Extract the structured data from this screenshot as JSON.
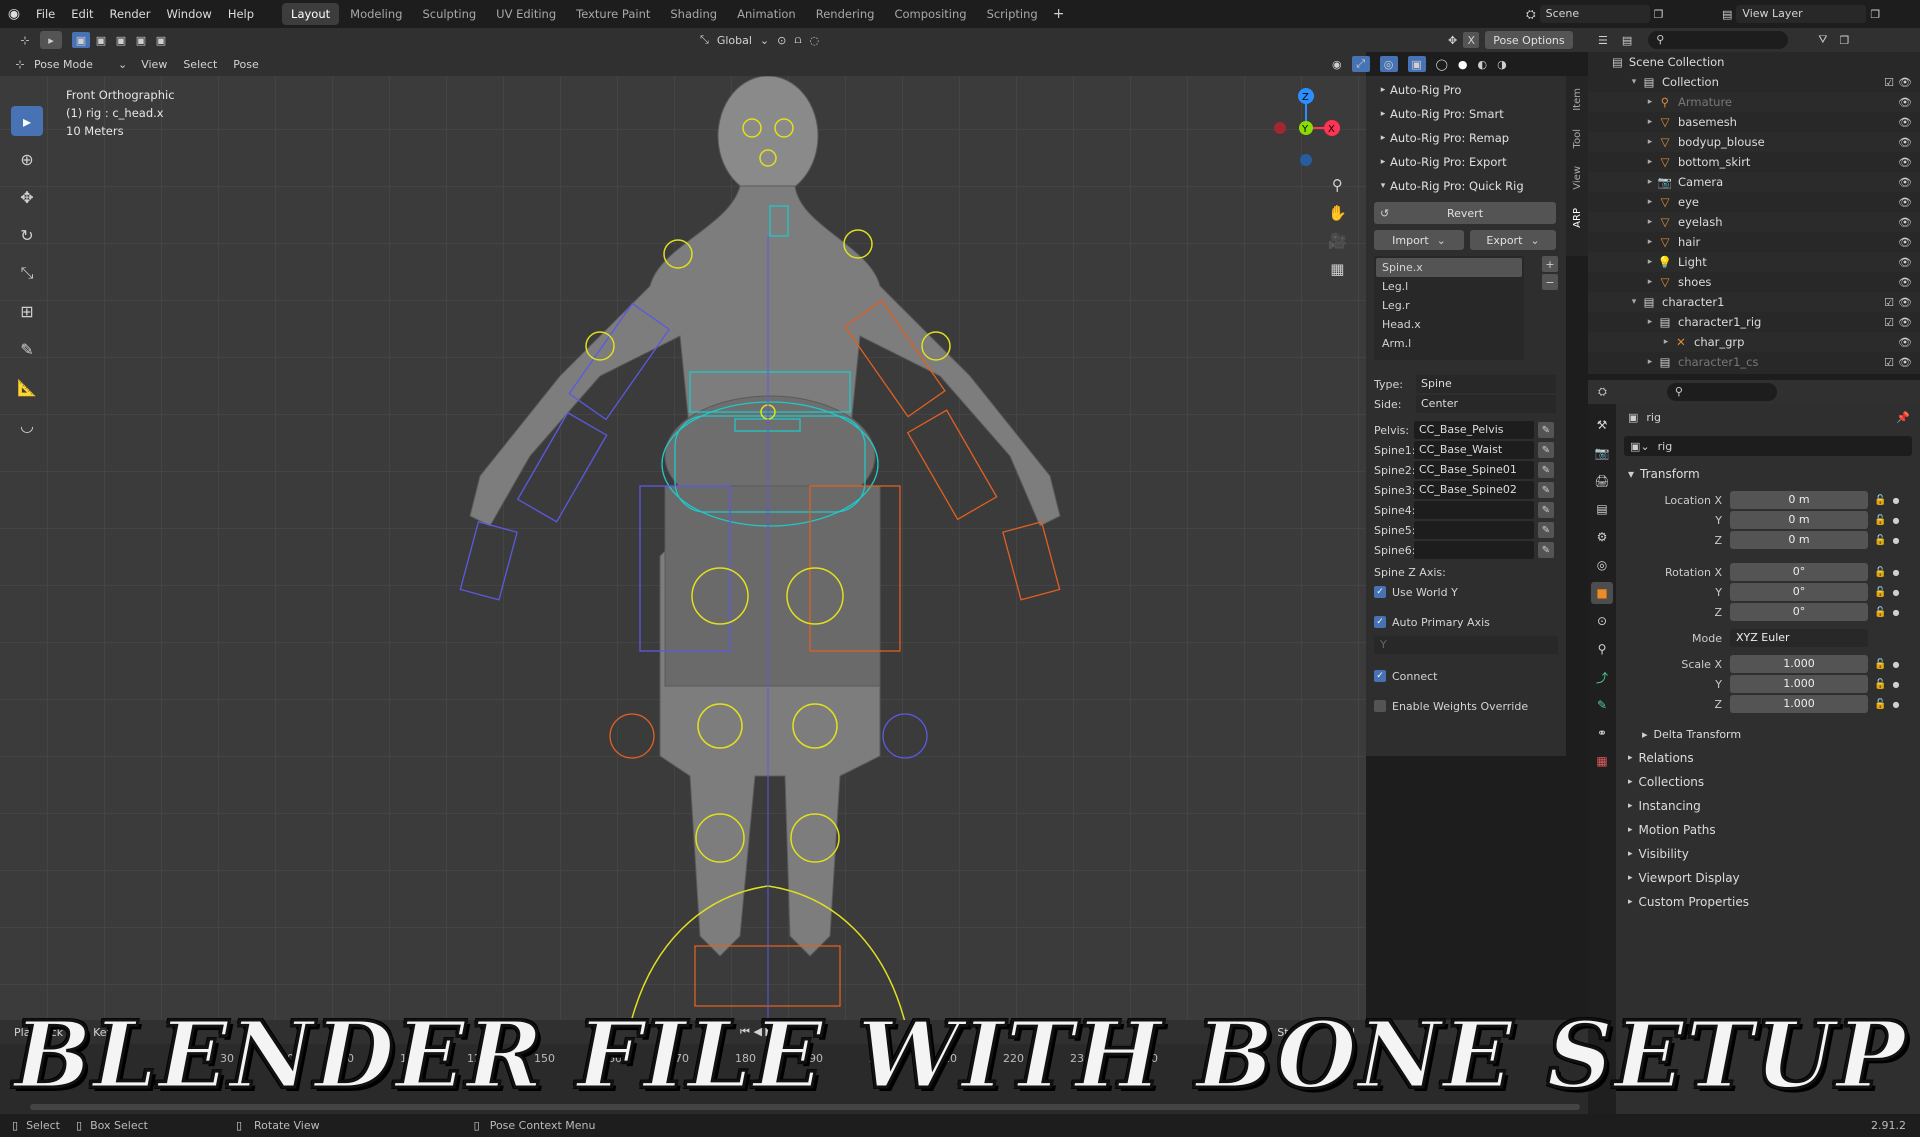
{
  "menu": [
    "File",
    "Edit",
    "Render",
    "Window",
    "Help"
  ],
  "workspaces": [
    "Layout",
    "Modeling",
    "Sculpting",
    "UV Editing",
    "Texture Paint",
    "Shading",
    "Animation",
    "Rendering",
    "Compositing",
    "Scripting"
  ],
  "active_workspace": "Layout",
  "scene_name": "Scene",
  "view_layer": "View Layer",
  "viewport_header": {
    "mode": "Pose Mode",
    "items": [
      "View",
      "Select",
      "Pose"
    ],
    "transform_orientation": "Global",
    "pose_options": "Pose Options"
  },
  "viewport_info": {
    "view": "Front Orthographic",
    "object": "(1) rig : c_head.x",
    "scale": "10 Meters"
  },
  "side_tabs": [
    "Item",
    "Tool",
    "View",
    "ARP"
  ],
  "arp_panel": {
    "sections": [
      "Auto-Rig Pro",
      "Auto-Rig Pro: Smart",
      "Auto-Rig Pro: Remap",
      "Auto-Rig Pro: Export",
      "Auto-Rig Pro: Quick Rig"
    ],
    "revert": "Revert",
    "import": "Import",
    "export": "Export",
    "limbs": [
      "Spine.x",
      "Leg.l",
      "Leg.r",
      "Head.x",
      "Arm.l"
    ],
    "type_label": "Type:",
    "type_value": "Spine",
    "side_label": "Side:",
    "side_value": "Center",
    "bones": [
      {
        "label": "Pelvis:",
        "value": "CC_Base_Pelvis"
      },
      {
        "label": "Spine1:",
        "value": "CC_Base_Waist"
      },
      {
        "label": "Spine2:",
        "value": "CC_Base_Spine01"
      },
      {
        "label": "Spine3:",
        "value": "CC_Base_Spine02"
      },
      {
        "label": "Spine4:",
        "value": ""
      },
      {
        "label": "Spine5:",
        "value": ""
      },
      {
        "label": "Spine6:",
        "value": ""
      }
    ],
    "spine_z_axis": "Spine Z Axis:",
    "use_world_y": "Use World Y",
    "auto_primary_axis": "Auto Primary Axis",
    "axis_value": "Y",
    "connect": "Connect",
    "enable_weights_override": "Enable Weights Override"
  },
  "outliner": {
    "root": "Scene Collection",
    "items": [
      {
        "name": "Collection",
        "indent": 1,
        "icon": "collection-icon"
      },
      {
        "name": "Armature",
        "indent": 2,
        "icon": "armature-icon",
        "dim": true
      },
      {
        "name": "basemesh",
        "indent": 2,
        "icon": "mesh-icon"
      },
      {
        "name": "bodyup_blouse",
        "indent": 2,
        "icon": "mesh-icon"
      },
      {
        "name": "bottom_skirt",
        "indent": 2,
        "icon": "mesh-icon"
      },
      {
        "name": "Camera",
        "indent": 2,
        "icon": "camera-icon"
      },
      {
        "name": "eye",
        "indent": 2,
        "icon": "mesh-icon"
      },
      {
        "name": "eyelash",
        "indent": 2,
        "icon": "mesh-icon"
      },
      {
        "name": "hair",
        "indent": 2,
        "icon": "mesh-icon"
      },
      {
        "name": "Light",
        "indent": 2,
        "icon": "light-icon"
      },
      {
        "name": "shoes",
        "indent": 2,
        "icon": "mesh-icon"
      },
      {
        "name": "character1",
        "indent": 1,
        "icon": "collection-icon"
      },
      {
        "name": "character1_rig",
        "indent": 2,
        "icon": "collection-icon"
      },
      {
        "name": "char_grp",
        "indent": 3,
        "icon": "empty-icon"
      },
      {
        "name": "character1_cs",
        "indent": 2,
        "icon": "collection-icon",
        "dim": true
      }
    ]
  },
  "properties": {
    "object_name": "rig",
    "data_name": "rig",
    "transform": "Transform",
    "location": [
      {
        "label": "Location X",
        "value": "0 m"
      },
      {
        "label": "Y",
        "value": "0 m"
      },
      {
        "label": "Z",
        "value": "0 m"
      }
    ],
    "rotation": [
      {
        "label": "Rotation X",
        "value": "0°"
      },
      {
        "label": "Y",
        "value": "0°"
      },
      {
        "label": "Z",
        "value": "0°"
      }
    ],
    "mode_label": "Mode",
    "mode_value": "XYZ Euler",
    "scale": [
      {
        "label": "Scale X",
        "value": "1.000"
      },
      {
        "label": "Y",
        "value": "1.000"
      },
      {
        "label": "Z",
        "value": "1.000"
      }
    ],
    "delta": "Delta Transform",
    "panels": [
      "Relations",
      "Collections",
      "Instancing",
      "Motion Paths",
      "Visibility",
      "Viewport Display",
      "Custom Properties"
    ]
  },
  "timeline": {
    "playback": "Playback",
    "keying": "Keying",
    "ticks": [
      "30",
      "50",
      "70",
      "100",
      "120",
      "150",
      "160",
      "170",
      "180",
      "190",
      "200",
      "210",
      "220",
      "230",
      "240"
    ],
    "start": "Start",
    "end": "End"
  },
  "statusbar": {
    "select": "Select",
    "box_select": "Box Select",
    "rotate_view": "Rotate View",
    "context_menu": "Pose Context Menu",
    "version": "2.91.2"
  },
  "caption": "BLENDER FILE WITH BONE SETUP",
  "colors": {
    "accent": "#4772b3",
    "bone_yellow": "#e0e020",
    "bone_orange": "#e06020",
    "bone_blue": "#5a5ae0",
    "bone_cyan": "#20c8c8"
  }
}
